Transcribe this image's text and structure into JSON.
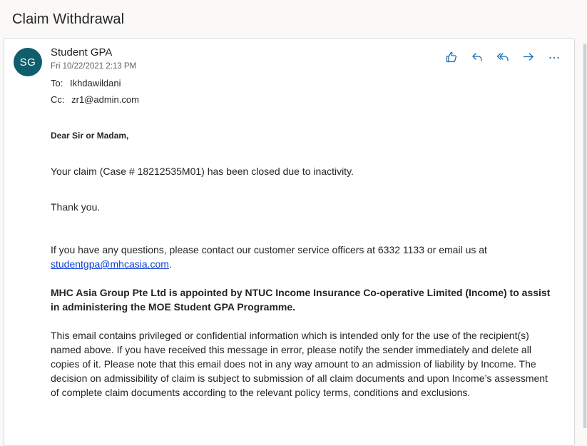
{
  "subject": "Claim Withdrawal",
  "colors": {
    "accent": "#0f6cbd",
    "avatar_bg": "#0f5e6b",
    "link": "#0b3fd6"
  },
  "message": {
    "avatar_initials": "SG",
    "sender": "Student GPA",
    "date": "Fri 10/22/2021 2:13 PM",
    "to_label": "To:",
    "to_value": "Ikhdawildani",
    "cc_label": "Cc:",
    "cc_value": "zr1@admin.com"
  },
  "actions": [
    {
      "icon": "thumbs-up-icon"
    },
    {
      "icon": "reply-icon"
    },
    {
      "icon": "reply-all-icon"
    },
    {
      "icon": "forward-icon"
    },
    {
      "icon": "more-icon"
    }
  ],
  "body": {
    "greeting": "Dear Sir or Madam,",
    "p1": "Your claim (Case # 18212535M01) has been closed due to inactivity.",
    "p2": "Thank you.",
    "p3_text": "If you have any questions, please contact our customer service officers at 6332 1133 or email us at",
    "p3_link": "studentgpa@mhcasia.com",
    "p3_end": ".",
    "p4": "MHC Asia Group Pte Ltd is appointed by NTUC Income Insurance Co-operative Limited (Income) to assist in administering the MOE Student GPA Programme.",
    "p5": "This email contains privileged or confidential information which is intended only for the use of the recipient(s) named above. If you have received this message in error, please notify the sender immediately and delete all copies of it. Please note that this email does not in any way amount to an admission of liability by Income. The decision on admissibility of claim is subject to submission of all claim documents and upon Income’s assessment of complete claim documents according to the relevant policy terms, conditions and exclusions."
  }
}
